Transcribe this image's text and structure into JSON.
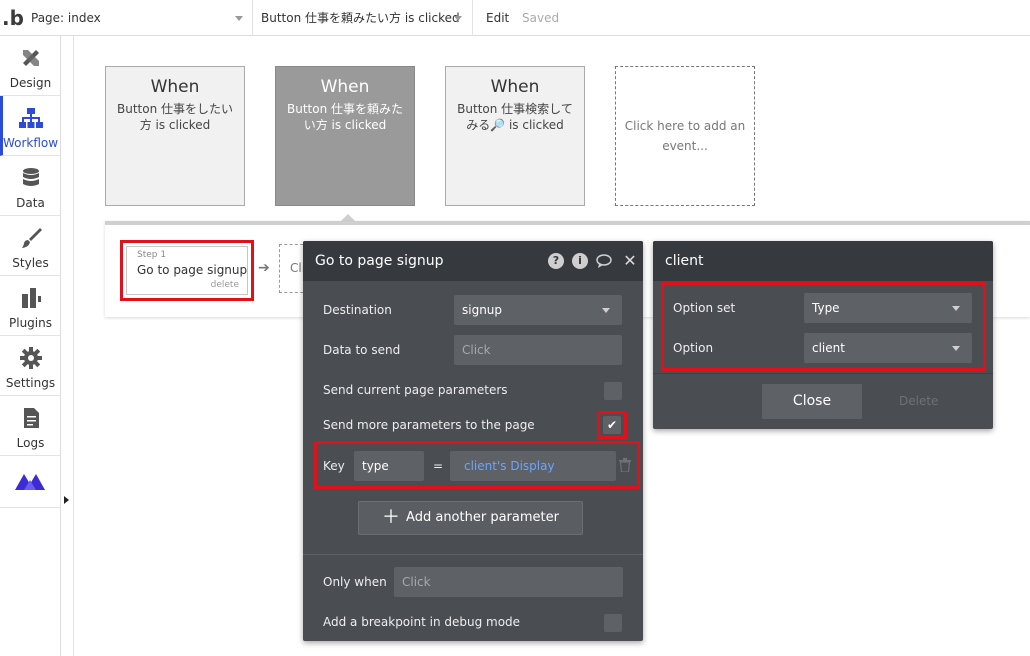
{
  "topbar": {
    "logo": ".b",
    "page_select": "Page: index",
    "event_select": "Button 仕事を頼みたい方 is clicked",
    "edit": "Edit",
    "status": "Saved"
  },
  "sidebar": {
    "items": [
      {
        "label": "Design",
        "icon": "design-icon"
      },
      {
        "label": "Workflow",
        "icon": "workflow-icon",
        "active": true
      },
      {
        "label": "Data",
        "icon": "database-icon"
      },
      {
        "label": "Styles",
        "icon": "brush-icon"
      },
      {
        "label": "Plugins",
        "icon": "plug-icon"
      },
      {
        "label": "Settings",
        "icon": "gear-icon"
      },
      {
        "label": "Logs",
        "icon": "document-icon"
      }
    ],
    "brand_icon": "bubble-logo-icon"
  },
  "events": [
    {
      "when": "When",
      "desc": "Button 仕事をしたい方 is clicked"
    },
    {
      "when": "When",
      "desc": "Button 仕事を頼みたい方 is clicked"
    },
    {
      "when": "When",
      "desc": "Button 仕事検索してみる🔎 is clicked"
    }
  ],
  "event_add": "Click here to add an event...",
  "step": {
    "num": "Step 1",
    "title": "Go to page signup",
    "delete": "delete",
    "next_placeholder": "Cli"
  },
  "panel": {
    "title": "Go to page signup",
    "icons": [
      "help-icon",
      "info-icon",
      "comment-icon",
      "close-icon"
    ],
    "destination_label": "Destination",
    "destination_value": "signup",
    "data_to_send_label": "Data to send",
    "data_to_send_placeholder": "Click",
    "send_current_label": "Send current page parameters",
    "send_current_checked": false,
    "send_more_label": "Send more parameters to the page",
    "send_more_checked": true,
    "key_label": "Key",
    "key_value": "type",
    "equals": "=",
    "param_value": "client's Display",
    "add_param_label": "Add another parameter",
    "only_when_label": "Only when",
    "only_when_placeholder": "Click",
    "breakpoint_label": "Add a breakpoint in debug mode",
    "breakpoint_checked": false
  },
  "panel2": {
    "title": "client",
    "option_set_label": "Option set",
    "option_set_value": "Type",
    "option_label": "Option",
    "option_value": "client",
    "close_label": "Close",
    "delete_label": "Delete"
  },
  "colors": {
    "highlight": "#e1111b",
    "accent": "#2a4cd8",
    "panel_bg": "#4a4d52",
    "panel_header": "#363a3f",
    "dynamic_text": "#6aa5ff"
  }
}
